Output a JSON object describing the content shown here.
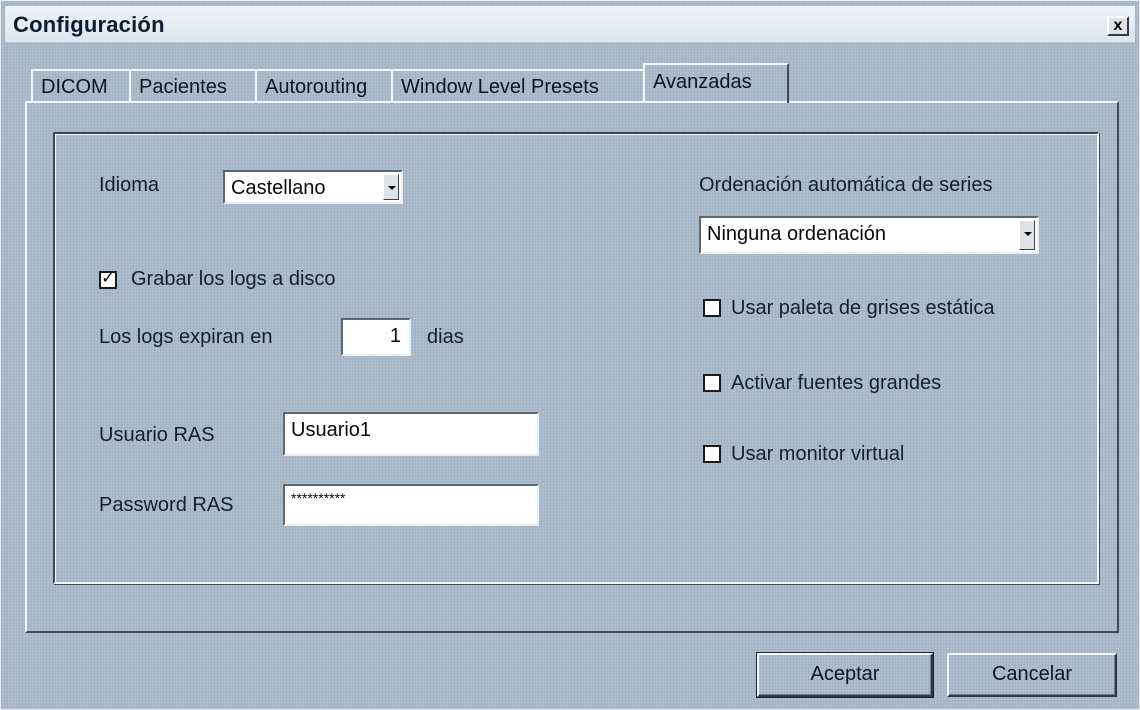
{
  "window": {
    "title": "Configuración",
    "close_label": "x"
  },
  "tabs": [
    {
      "label": "DICOM"
    },
    {
      "label": "Pacientes"
    },
    {
      "label": "Autorouting"
    },
    {
      "label": "Window Level Presets"
    },
    {
      "label": "Avanzadas",
      "active": true
    }
  ],
  "advanced": {
    "language_label": "Idioma",
    "language_value": "Castellano",
    "save_logs_label": "Grabar los logs a disco",
    "save_logs_checked": true,
    "logs_expire_label": "Los logs expiran en",
    "logs_expire_value": "1",
    "logs_expire_unit": "dias",
    "ras_user_label": "Usuario RAS",
    "ras_user_value": "Usuario1",
    "ras_password_label": "Password RAS",
    "ras_password_value": "**********",
    "sort_label": "Ordenación automática de series",
    "sort_value": "Ninguna ordenación",
    "static_gray_label": "Usar paleta de grises estática",
    "static_gray_checked": false,
    "large_fonts_label": "Activar fuentes grandes",
    "large_fonts_checked": false,
    "virtual_monitor_label": "Usar monitor virtual",
    "virtual_monitor_checked": false
  },
  "buttons": {
    "accept": "Aceptar",
    "cancel": "Cancelar"
  }
}
